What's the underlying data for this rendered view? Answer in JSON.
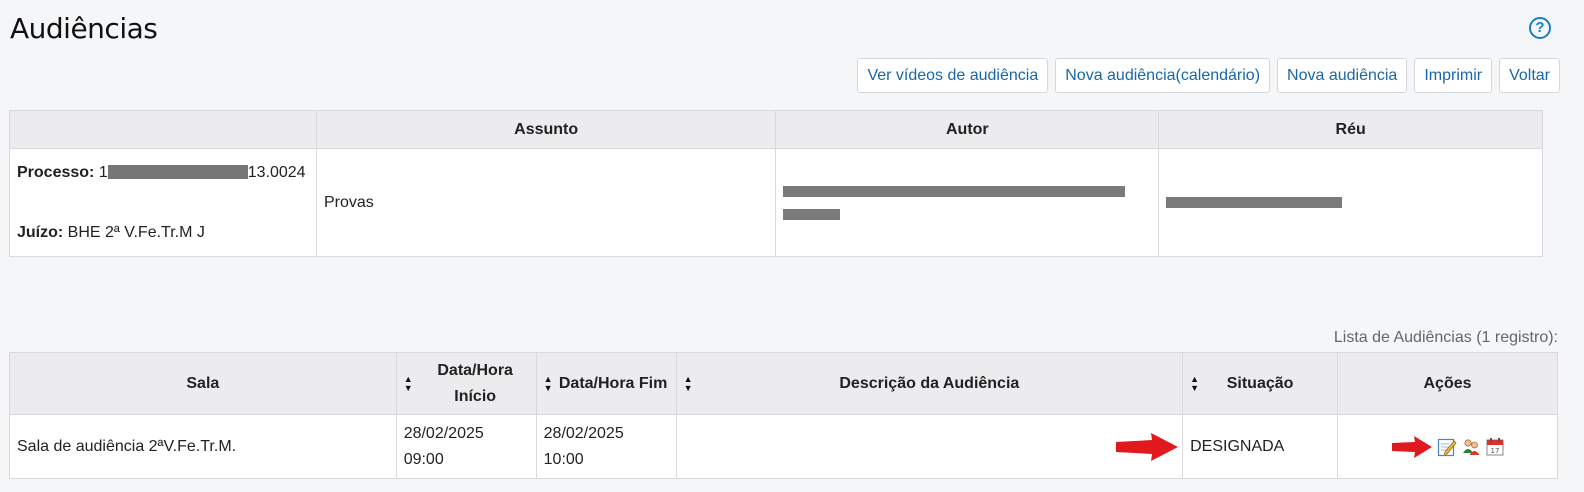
{
  "page": {
    "title": "Audiências",
    "help_label": "?"
  },
  "toolbar": {
    "buttons": [
      {
        "label": "Ver vídeos de audiência"
      },
      {
        "label": "Nova audiência(calendário)"
      },
      {
        "label": "Nova audiência"
      },
      {
        "label": "Imprimir"
      },
      {
        "label": "Voltar"
      }
    ]
  },
  "process": {
    "headers": [
      "",
      "Assunto",
      "Autor",
      "Réu"
    ],
    "processo_label": "Processo:",
    "processo_prefix": "1",
    "processo_suffix": "13.0024",
    "juizo_label": "Juízo:",
    "juizo_value": "BHE 2ª V.Fe.Tr.M J",
    "assunto": "Provas"
  },
  "list": {
    "caption": "Lista de Audiências (1 registro):",
    "headers": {
      "sala": "Sala",
      "inicio": "Data/Hora Início",
      "fim": "Data/Hora Fim",
      "descricao": "Descrição da Audiência",
      "situacao": "Situação",
      "acoes": "Ações"
    },
    "rows": [
      {
        "sala": "Sala de audiência 2ªV.Fe.Tr.M.",
        "inicio_date": "28/02/2025",
        "inicio_time": "09:00",
        "fim_date": "28/02/2025",
        "fim_time": "10:00",
        "descricao": "",
        "situacao": "DESIGNADA",
        "actions": [
          "edit-icon",
          "participants-icon",
          "calendar-icon"
        ]
      }
    ]
  },
  "colors": {
    "accent": "#1867a8",
    "arrow": "#e0191e"
  }
}
